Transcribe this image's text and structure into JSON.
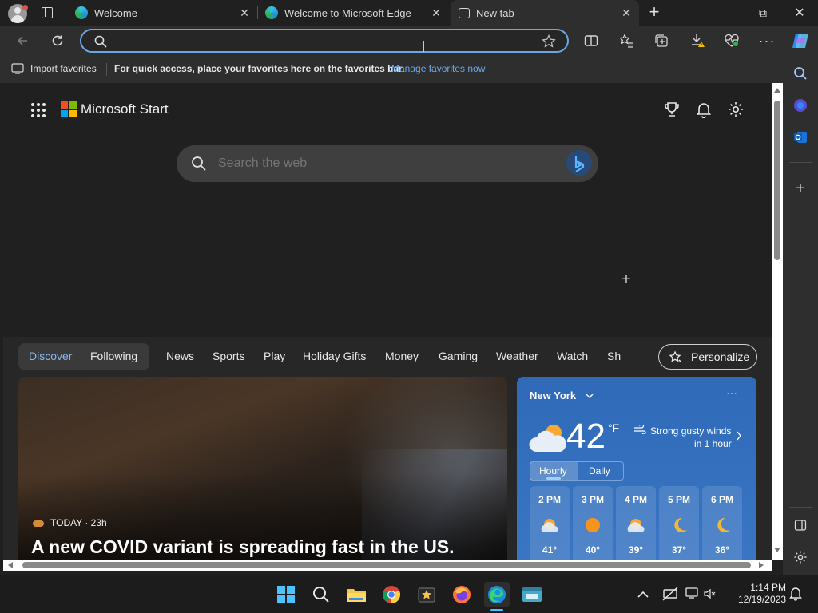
{
  "browser": {
    "tabs": [
      {
        "title": "Welcome",
        "close": "✕"
      },
      {
        "title": "Welcome to Microsoft Edge",
        "close": "✕"
      },
      {
        "title": "New tab",
        "close": "✕",
        "active": true
      }
    ],
    "new_tab_glyph": "+",
    "window_controls": {
      "minimize": "—",
      "restore": "⧉",
      "close": "✕"
    },
    "address_value": "",
    "favorites_bar": {
      "import_label": "Import favorites",
      "hint_text": "For quick access, place your favorites here on the favorites bar.",
      "manage_link": "Manage favorites now"
    }
  },
  "newtab": {
    "brand": "Microsoft Start",
    "search_placeholder": "Search the web",
    "add_tile_glyph": "+",
    "nav": {
      "discover": "Discover",
      "following": "Following",
      "items": [
        "News",
        "Sports",
        "Play",
        "Holiday Gifts",
        "Money",
        "Gaming",
        "Weather",
        "Watch",
        "Sh"
      ],
      "personalize": "Personalize"
    },
    "hero": {
      "source": "TODAY · 23h",
      "headline": "A new COVID variant is spreading fast in the US."
    },
    "weather": {
      "location": "New York",
      "more": "···",
      "temp": "42",
      "unit": "°F",
      "alert_line1": "Strong gusty winds",
      "alert_line2": "in 1 hour",
      "tab_hourly": "Hourly",
      "tab_daily": "Daily",
      "hours": [
        {
          "time": "2 PM",
          "temp": "41°",
          "icon": "partly-sunny-icon"
        },
        {
          "time": "3 PM",
          "temp": "40°",
          "icon": "sun-icon"
        },
        {
          "time": "4 PM",
          "temp": "39°",
          "icon": "partly-sunny-icon"
        },
        {
          "time": "5 PM",
          "temp": "37°",
          "icon": "moon-icon"
        },
        {
          "time": "6 PM",
          "temp": "36°",
          "icon": "moon-icon"
        }
      ]
    }
  },
  "taskbar": {
    "time": "1:14 PM",
    "date": "12/19/2023"
  },
  "colors": {
    "accent": "#6aa7e6",
    "weather_bg": "#2f67b1",
    "link": "#6aa7e6"
  }
}
